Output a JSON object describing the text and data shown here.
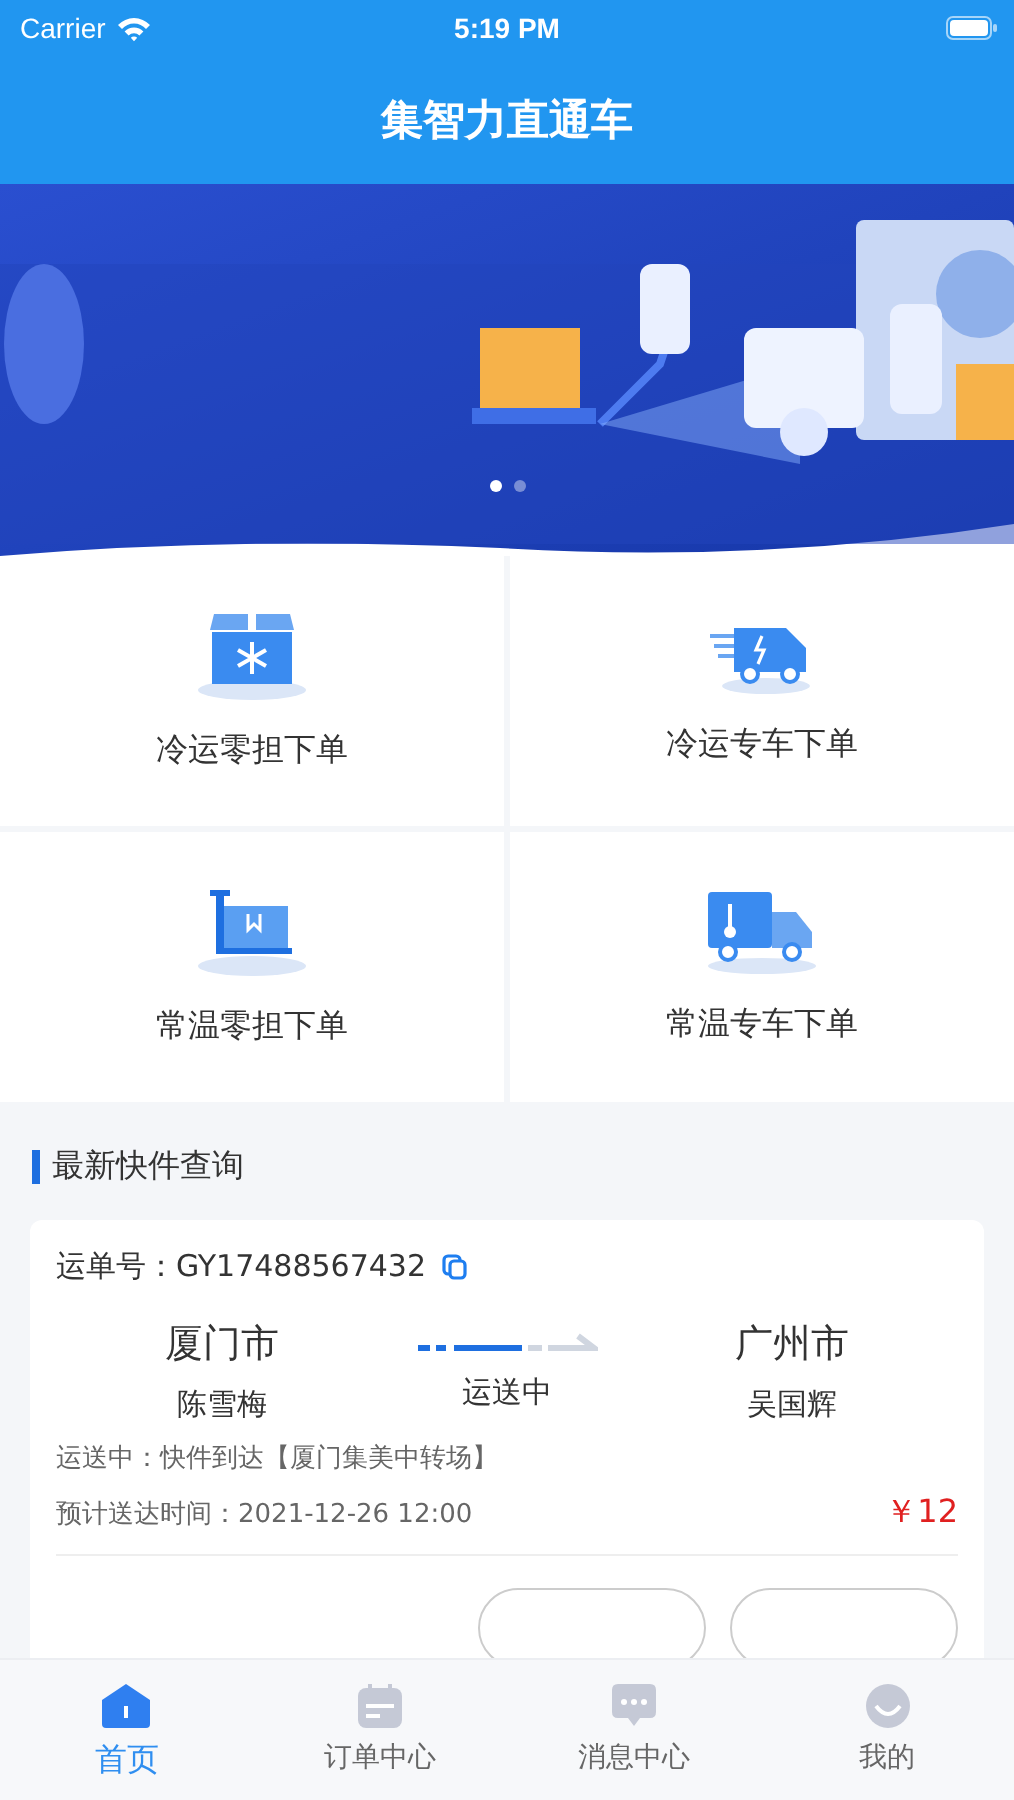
{
  "status_bar": {
    "carrier": "Carrier",
    "time": "5:19 PM"
  },
  "nav": {
    "title": "集智力直通车"
  },
  "banner": {
    "dots": [
      {
        "selected": true
      },
      {
        "selected": false
      }
    ]
  },
  "services": [
    {
      "label": "冷运零担下单",
      "kind": "cold-box"
    },
    {
      "label": "冷运专车下单",
      "kind": "fast-van"
    },
    {
      "label": "常温零担下单",
      "kind": "cart"
    },
    {
      "label": "常温专车下单",
      "kind": "truck"
    }
  ],
  "section": {
    "title": "最新快件查询"
  },
  "shipment": {
    "number_label": "运单号：",
    "number": "GY17488567432",
    "from_city": "厦门市",
    "from_name": "陈雪梅",
    "status": "运送中",
    "to_city": "广州市",
    "to_name": "吴国辉",
    "progress_text": "运送中：快件到达【厦门集美中转场】",
    "eta_label": "预计送达时间：",
    "eta": "2021-12-26 12:00",
    "price": "￥12",
    "buttons": [
      {
        "kind": "outline"
      },
      {
        "kind": "outline"
      }
    ]
  },
  "tabs": [
    {
      "label": "首页",
      "kind": "home",
      "selected": true
    },
    {
      "label": "订单中心",
      "kind": "calendar",
      "selected": false
    },
    {
      "label": "消息中心",
      "kind": "chat",
      "selected": false
    },
    {
      "label": "我的",
      "kind": "smile",
      "selected": false
    }
  ]
}
